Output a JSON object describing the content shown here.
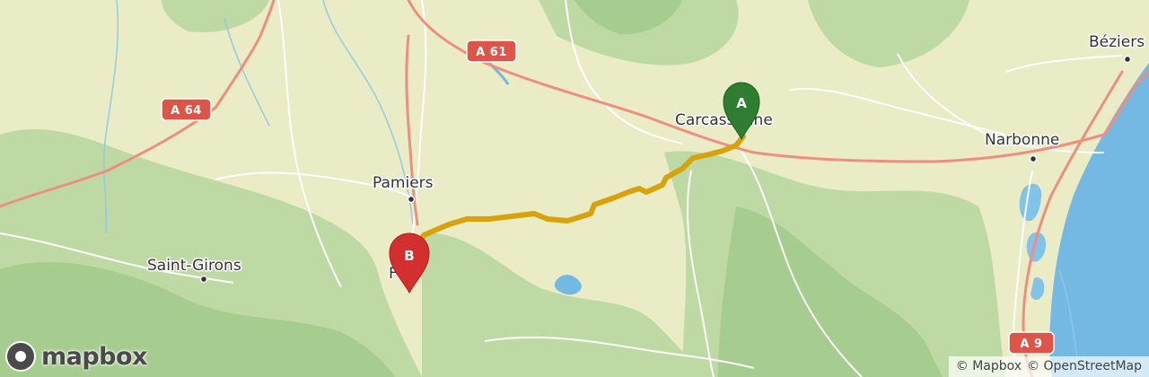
{
  "map": {
    "colors": {
      "land": "#e9ecc4",
      "forest": "#b9d7a0",
      "forest_dark": "#9cc486",
      "water": "#74b8e4",
      "water_lake": "#82c3ea",
      "motorway": "#ef8e80",
      "road": "#ffffff",
      "route": "#d9a20b",
      "marker_start": "#2e7d32",
      "marker_end": "#d32f2f"
    },
    "cities": [
      {
        "name": "Carcassonne"
      },
      {
        "name": "Béziers"
      },
      {
        "name": "Narbonne"
      },
      {
        "name": "Pamiers"
      },
      {
        "name": "Saint-Girons"
      },
      {
        "name": "Foix"
      }
    ],
    "road_shields": [
      {
        "ref": "A 61"
      },
      {
        "ref": "A 64"
      },
      {
        "ref": "A 9"
      }
    ],
    "markers": {
      "start": {
        "label": "A",
        "place": "Carcassonne"
      },
      "end": {
        "label": "B",
        "place": "Foix"
      }
    }
  },
  "branding": {
    "logo_text": "mapbox",
    "logo_icon": "mapbox-logo-icon"
  },
  "attribution": {
    "mapbox": "© Mapbox",
    "osm": "© OpenStreetMap"
  }
}
